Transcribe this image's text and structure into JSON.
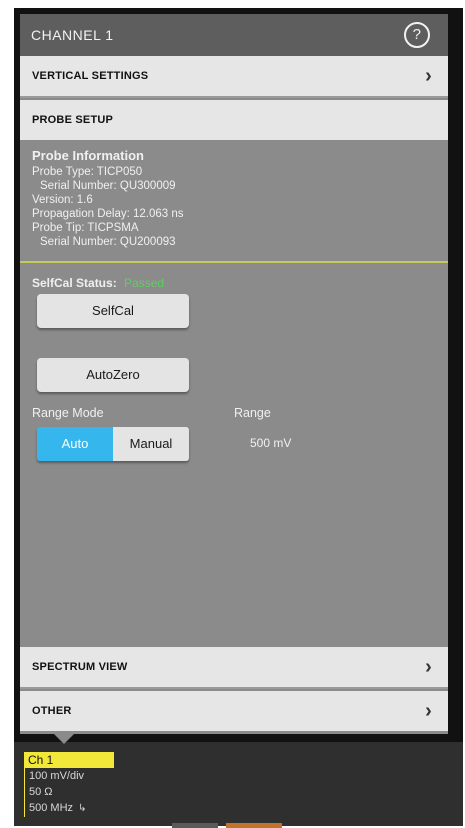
{
  "header": {
    "title": "CHANNEL 1",
    "help_icon": "help-icon"
  },
  "sections": {
    "vertical_settings": "VERTICAL SETTINGS",
    "probe_setup": "PROBE SETUP",
    "spectrum_view": "SPECTRUM VIEW",
    "other": "OTHER"
  },
  "probe_info": {
    "title": "Probe Information",
    "probe_type": "Probe Type: TICP050",
    "serial_number": "Serial Number: QU300009",
    "version": "Version: 1.6",
    "propagation_delay": "Propagation Delay: 12.063 ns",
    "probe_tip": "Probe Tip: TICPSMA",
    "tip_serial_number": "Serial Number: QU200093"
  },
  "selfcal": {
    "status_label": "SelfCal Status:",
    "status_value": "Passed",
    "status_color": "#5fcf5f",
    "button": "SelfCal"
  },
  "autozero": {
    "button": "AutoZero"
  },
  "range_mode": {
    "label": "Range Mode",
    "options": [
      "Auto",
      "Manual"
    ],
    "selected": "Auto",
    "accent": "#35b6ec"
  },
  "range": {
    "label": "Range",
    "value": "500 mV"
  },
  "channel_badge": {
    "title": "Ch 1",
    "scale": "100 mV/div",
    "impedance": "50 Ω",
    "bandwidth": "500 MHz",
    "bw_icon": "bandwidth-limit-icon",
    "color": "#f2e83a"
  }
}
